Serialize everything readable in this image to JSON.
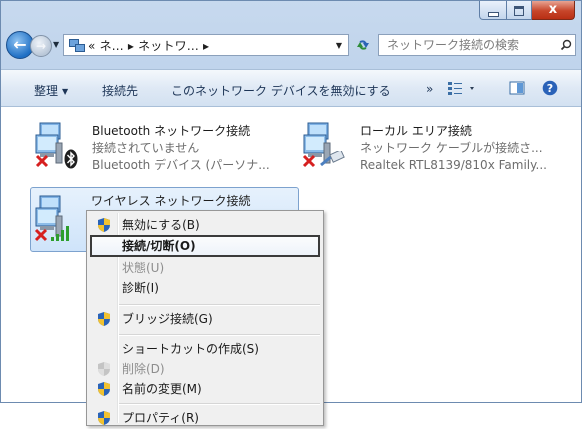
{
  "window": {
    "caption_close": "x"
  },
  "nav": {
    "address_prefix": "«",
    "address_seg1": "ネ...",
    "address_seg2": "ネットワ...",
    "address_sep": "▸",
    "search_placeholder": "ネットワーク接続の検索"
  },
  "toolbar": {
    "organize": "整理",
    "connect_to": "接続先",
    "disable_device": "このネットワーク デバイスを無効にする",
    "more": "»"
  },
  "connections": [
    {
      "name": "Bluetooth ネットワーク接続",
      "status": "接続されていません",
      "device": "Bluetooth デバイス (パーソナ..."
    },
    {
      "name": "ローカル エリア接続",
      "status": "ネットワーク ケーブルが接続さ...",
      "device": "Realtek RTL8139/810x Family..."
    },
    {
      "name": "ワイヤレス ネットワーク接続"
    }
  ],
  "context_menu": {
    "items": [
      "無効にする(B)",
      "接続/切断(O)",
      "状態(U)",
      "診断(I)",
      "ブリッジ接続(G)",
      "ショートカットの作成(S)",
      "削除(D)",
      "名前の変更(M)",
      "プロパティ(R)"
    ]
  },
  "colors": {
    "accent": "#1f6fc4",
    "error_x": "#d62020",
    "signal": "#2d9e2d",
    "highlight_border": "#3b3b3b"
  }
}
